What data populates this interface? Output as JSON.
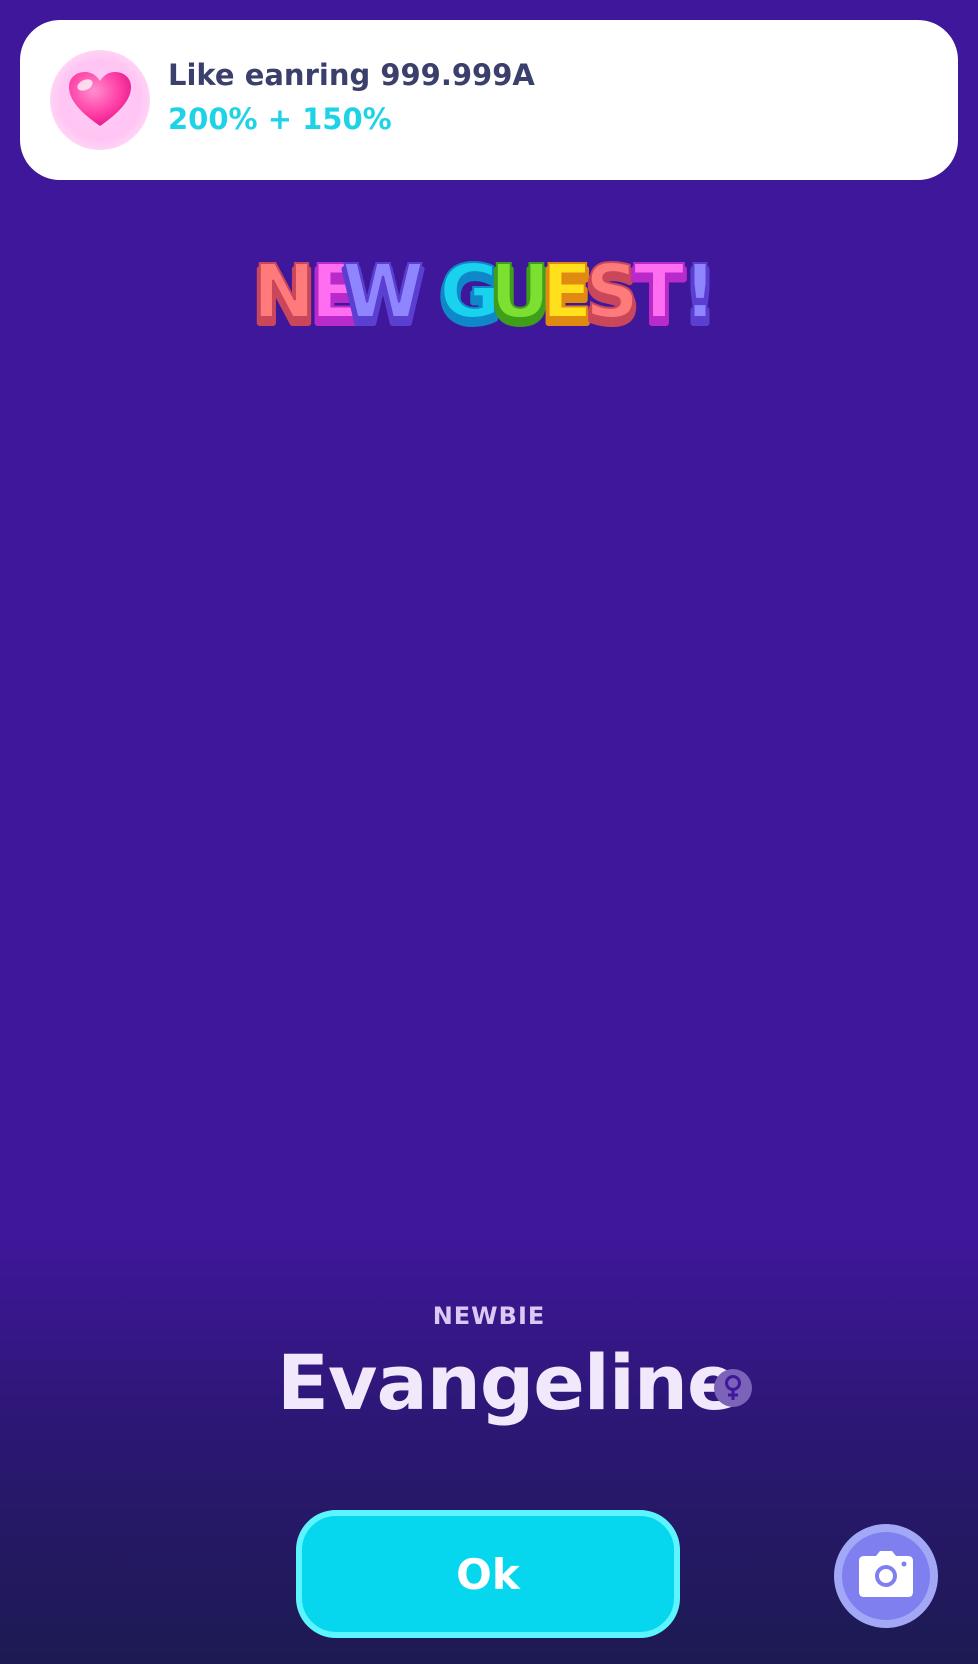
{
  "notification": {
    "icon": "heart-icon",
    "title": "Like eanring 999.999A",
    "subtitle": "200% + 150%"
  },
  "headline": {
    "words": [
      "NEW",
      "GUEST!"
    ],
    "letters": [
      {
        "char": "N",
        "color": "#ff7a7a"
      },
      {
        "char": "E",
        "color": "#ff6ef0"
      },
      {
        "char": "W",
        "color": "#8f86ff"
      },
      {
        "char": "G",
        "color": "#18d2ee"
      },
      {
        "char": "U",
        "color": "#7be02f"
      },
      {
        "char": "E",
        "color": "#ffe01a"
      },
      {
        "char": "S",
        "color": "#ff7a7a"
      },
      {
        "char": "T",
        "color": "#ff6ef0"
      },
      {
        "char": "!",
        "color": "#8f86ff"
      }
    ]
  },
  "guest": {
    "rank": "NEWBIE",
    "name": "Evangeline",
    "gender_icon": "female-icon"
  },
  "actions": {
    "ok_label": "Ok",
    "camera_icon": "camera-icon"
  },
  "colors": {
    "background": "#3f179b",
    "accent": "#06d7ee",
    "subtitle": "#1fd3e6"
  }
}
